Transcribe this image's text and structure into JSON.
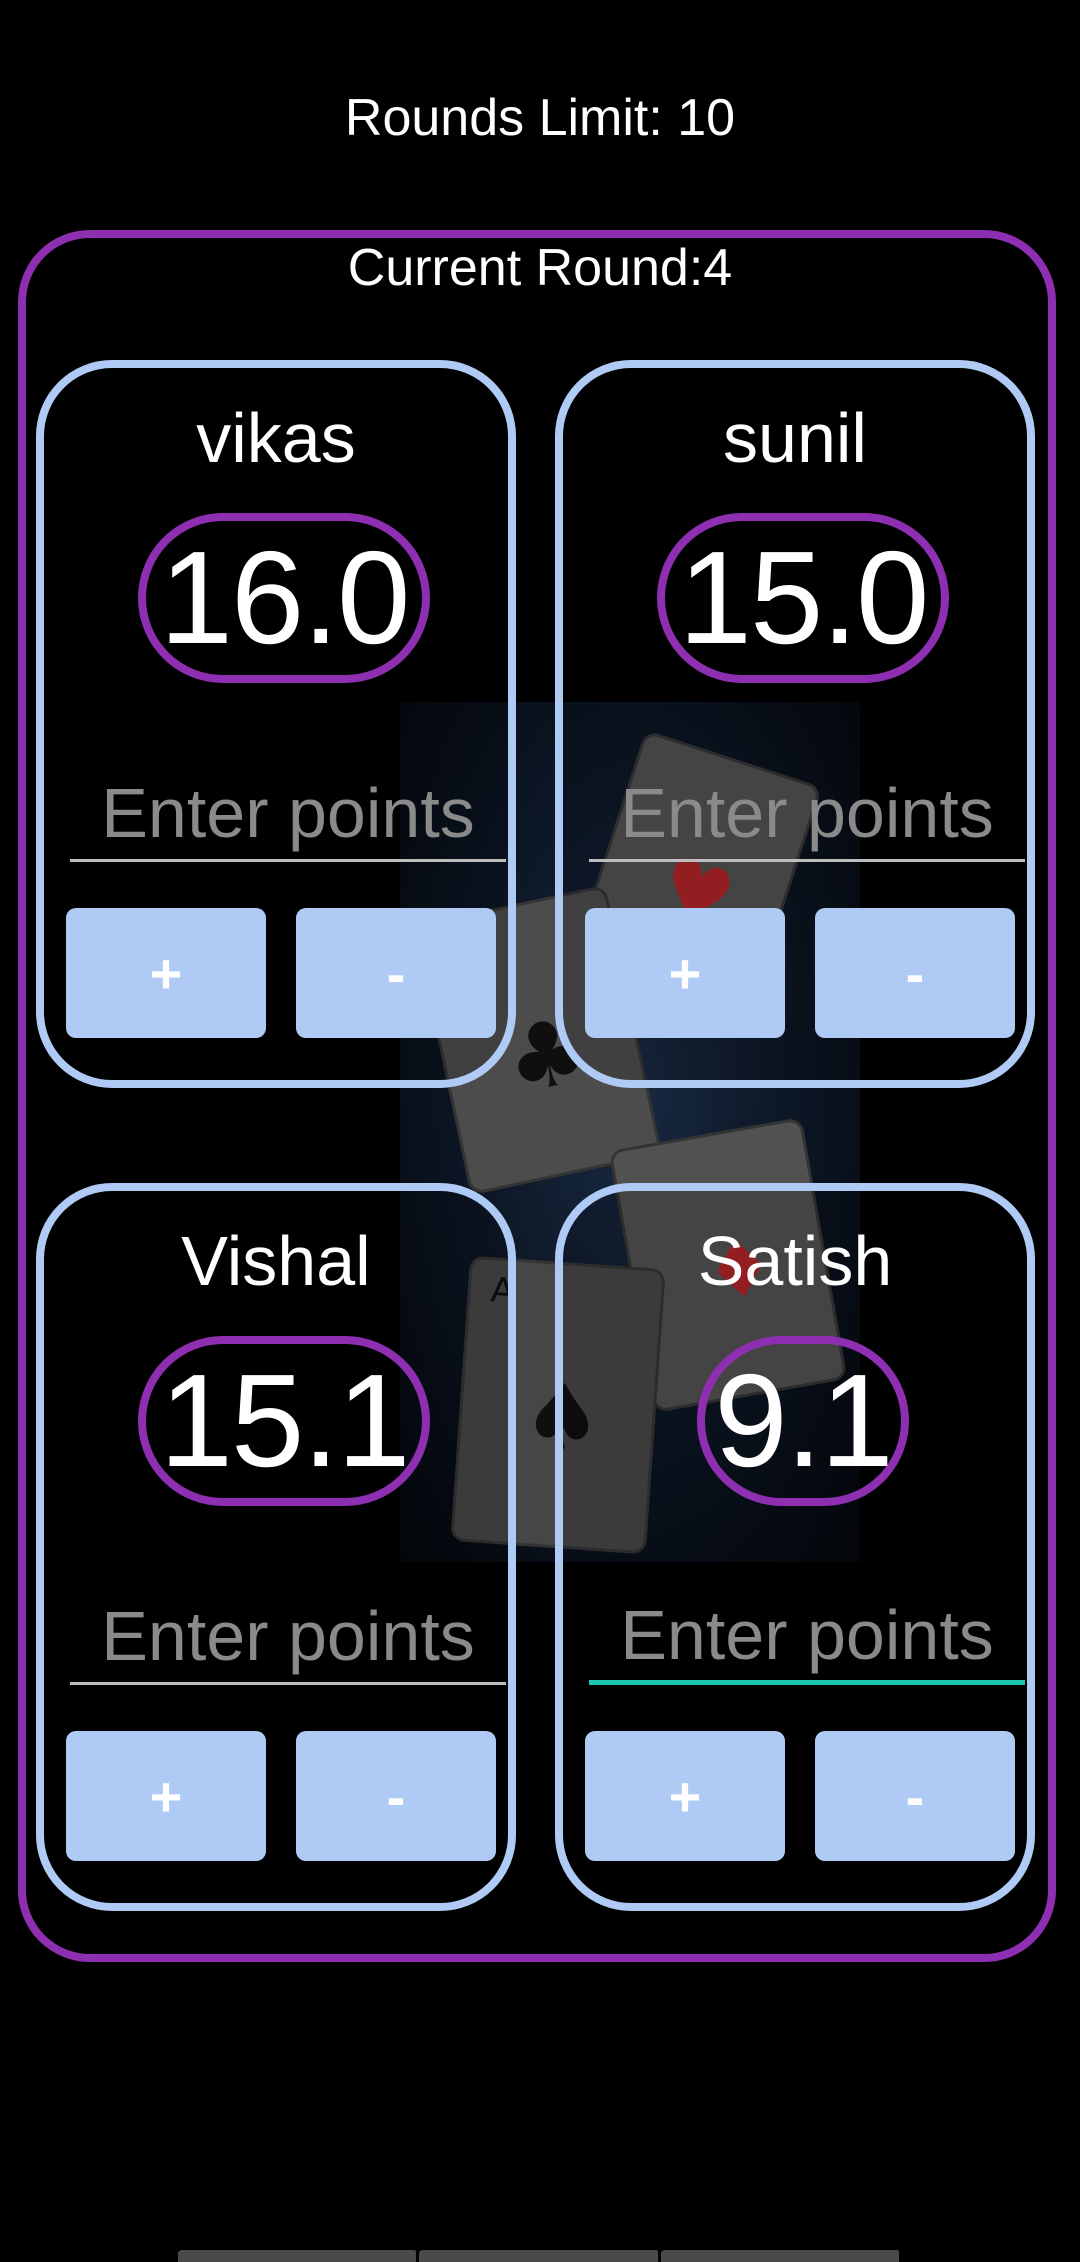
{
  "header": {
    "rounds_limit": "Rounds Limit: 10",
    "current_round": "Current Round:4"
  },
  "players": [
    {
      "name": "vikas",
      "score": "16.0",
      "placeholder": "Enter points",
      "plus_label": "+",
      "minus_label": "-"
    },
    {
      "name": "sunil",
      "score": "15.0",
      "placeholder": "Enter points",
      "plus_label": "+",
      "minus_label": "-"
    },
    {
      "name": "Vishal",
      "score": "15.1",
      "placeholder": "Enter points",
      "plus_label": "+",
      "minus_label": "-"
    },
    {
      "name": "Satish",
      "score": "9.1",
      "placeholder": "Enter points",
      "plus_label": "+",
      "minus_label": "-"
    }
  ],
  "colors": {
    "background": "#000000",
    "outer_border": "#8E2FB1",
    "card_border": "#AFCBF5",
    "score_oval_border": "#8E2FB1",
    "button_fill": "#AFCBF5",
    "focused_underline": "#1FC6B0"
  },
  "icons": {
    "background_image": "playing-cards-illustration"
  }
}
